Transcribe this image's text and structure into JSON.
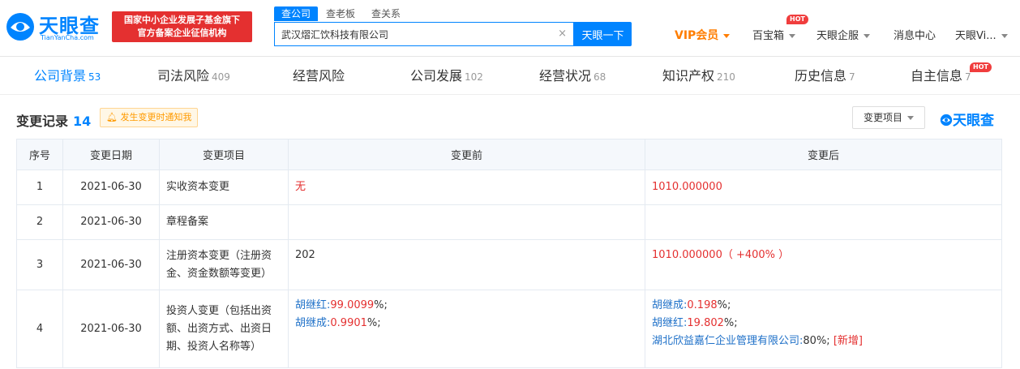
{
  "header": {
    "logo_text": "天眼查",
    "logo_sub": "TianYanCha.com",
    "slogan_line1": "国家中小企业发展子基金旗下",
    "slogan_line2": "官方备案企业征信机构",
    "search_tabs": [
      "查公司",
      "查老板",
      "查关系"
    ],
    "search_value": "武汉熠汇饮科技有限公司",
    "search_clear": "×",
    "search_button": "天眼一下",
    "nav": {
      "vip": "VIP会员",
      "baibaoxiang": "百宝箱",
      "hot": "HOT",
      "enterprise": "天眼企服",
      "messages": "消息中心",
      "user": "天眼Vi..."
    }
  },
  "tabs": [
    {
      "label": "公司背景",
      "count": "53"
    },
    {
      "label": "司法风险",
      "count": "409"
    },
    {
      "label": "经营风险",
      "count": ""
    },
    {
      "label": "公司发展",
      "count": "102"
    },
    {
      "label": "经营状况",
      "count": "68"
    },
    {
      "label": "知识产权",
      "count": "210"
    },
    {
      "label": "历史信息",
      "count": "7"
    },
    {
      "label": "自主信息",
      "count": "7"
    }
  ],
  "tabs_hot": "HOT",
  "section": {
    "title": "变更记录",
    "count": "14",
    "notify": "发生变更时通知我",
    "filter": "变更项目",
    "brand": "天眼查"
  },
  "table": {
    "headers": [
      "序号",
      "变更日期",
      "变更项目",
      "变更前",
      "变更后"
    ],
    "rows": [
      {
        "no": "1",
        "date": "2021-06-30",
        "item": "实收资本变更",
        "before": "无",
        "after": "1010.000000"
      },
      {
        "no": "2",
        "date": "2021-06-30",
        "item": "章程备案",
        "before": "",
        "after": ""
      },
      {
        "no": "3",
        "date": "2021-06-30",
        "item": "注册资本变更（注册资金、资金数额等变更）",
        "before": "202",
        "after": "1010.000000（ +400% ）"
      },
      {
        "no": "4",
        "date": "2021-06-30",
        "item": "投资人变更（包括出资额、出资方式、出资日期、投资人名称等）",
        "before_lines": [
          {
            "name": "胡继红:",
            "val": "99.0099",
            "pct": "%;"
          },
          {
            "name": "胡继成:",
            "val": "0.9901",
            "pct": "%;"
          }
        ],
        "after_lines": [
          {
            "name": "胡继成:",
            "val": "0.198",
            "pct": "%;",
            "tag": ""
          },
          {
            "name": "胡继红:",
            "val": "19.802",
            "pct": "%;",
            "tag": ""
          },
          {
            "name": "湖北欣益嘉仁企业管理有限公司:",
            "val": "80",
            "pct": "%;",
            "tag": "[新增]"
          }
        ]
      }
    ]
  }
}
